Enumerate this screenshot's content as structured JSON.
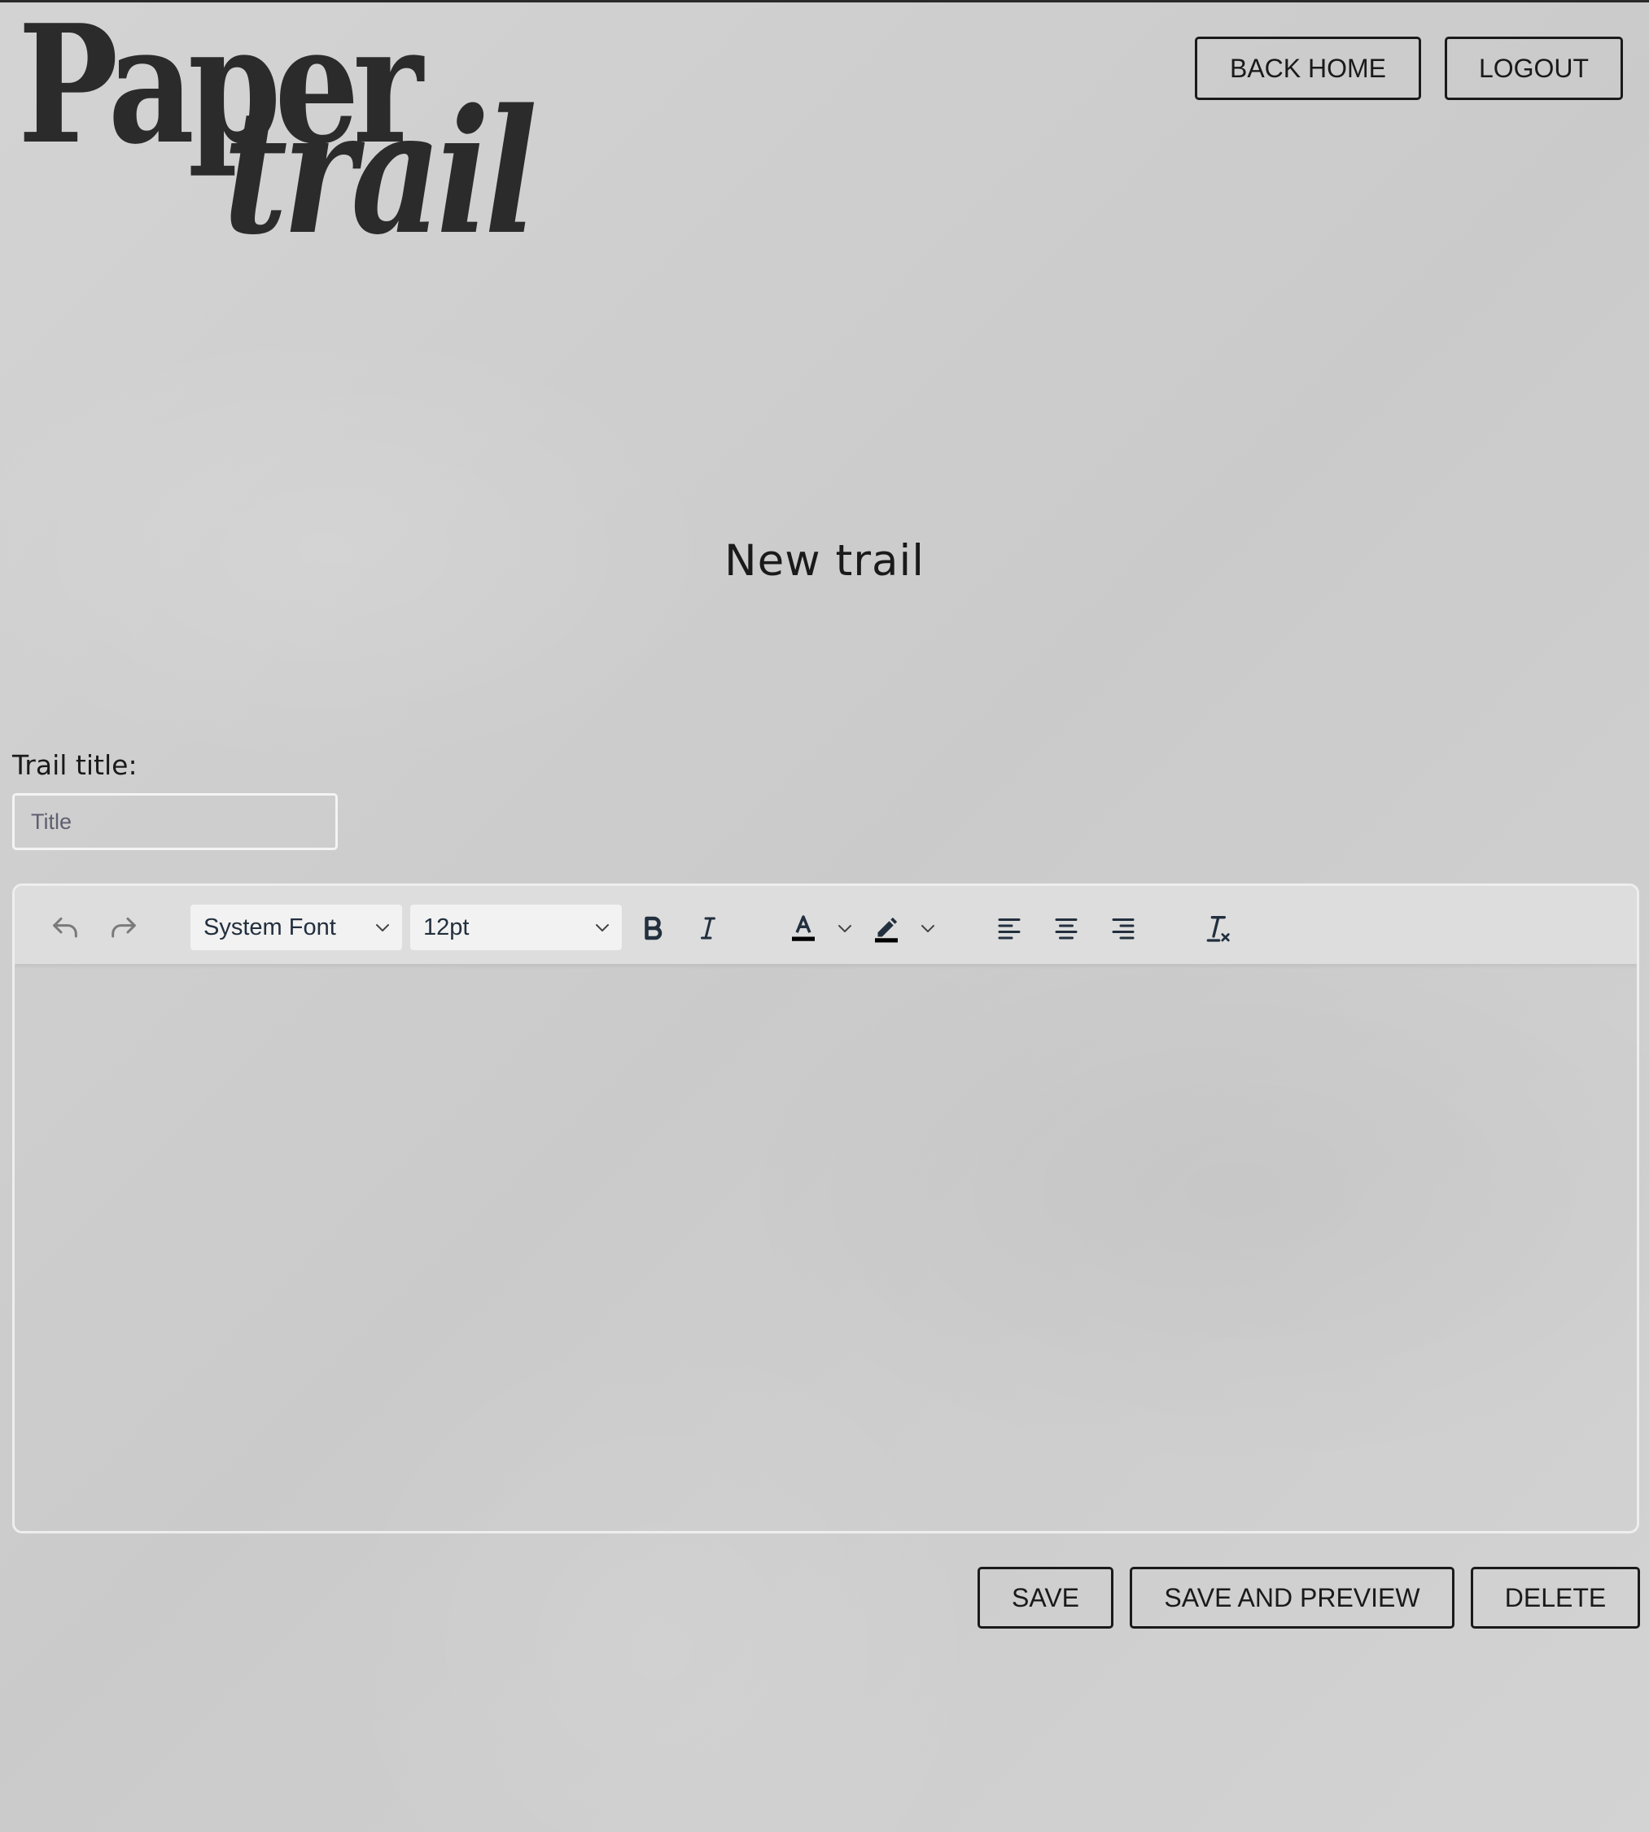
{
  "logo": {
    "line1": "Paper",
    "line2": "trail"
  },
  "header": {
    "back_home_label": "BACK HOME",
    "logout_label": "LOGOUT"
  },
  "page": {
    "heading": "New trail"
  },
  "form": {
    "title_label": "Trail title:",
    "title_placeholder": "Title",
    "title_value": ""
  },
  "editor": {
    "toolbar": {
      "undo_icon": "undo-icon",
      "redo_icon": "redo-icon",
      "font_family_value": "System Font",
      "font_size_value": "12pt",
      "bold_icon": "bold-icon",
      "italic_icon": "italic-icon",
      "text_color_icon": "text-color-icon",
      "highlight_icon": "highlight-color-icon",
      "align_left_icon": "align-left-icon",
      "align_center_icon": "align-center-icon",
      "align_right_icon": "align-right-icon",
      "clear_formatting_icon": "clear-formatting-icon",
      "text_color_swatch": "#000000",
      "highlight_swatch": "#000000"
    },
    "content": ""
  },
  "actions": {
    "save_label": "SAVE",
    "save_preview_label": "SAVE AND PREVIEW",
    "delete_label": "DELETE"
  },
  "colors": {
    "background": "#d1d1d1",
    "text": "#1a1a1a",
    "toolbar_bg": "#dddddd",
    "toolbar_icon": "#222f3e"
  }
}
